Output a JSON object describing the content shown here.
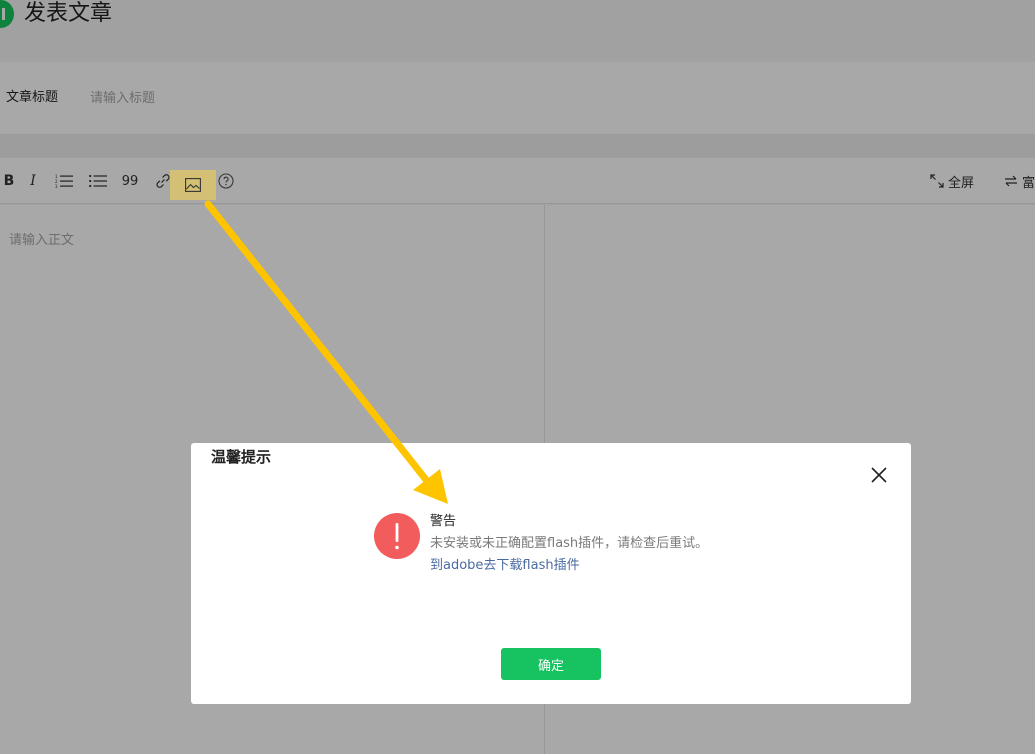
{
  "header": {
    "title": "发表文章"
  },
  "title_field": {
    "label": "文章标题",
    "placeholder": "请输入标题",
    "value": ""
  },
  "toolbar": {
    "bold": "B",
    "italic": "I",
    "quote": "99",
    "fullscreen_label": "全屏",
    "rich_label": "富"
  },
  "editor": {
    "placeholder": "请输入正文"
  },
  "dialog": {
    "title": "温馨提示",
    "alert_title": "警告",
    "message": "未安装或未正确配置flash插件，请检查后重试。",
    "link_text": "到adobe去下载flash插件",
    "confirm_label": "确定"
  },
  "colors": {
    "brand_green": "#17c360",
    "alert_red": "#f25c5c",
    "link_blue": "#4a6aa0",
    "highlight_yellow": "#fbe38a",
    "annotation_arrow": "#ffc400"
  }
}
